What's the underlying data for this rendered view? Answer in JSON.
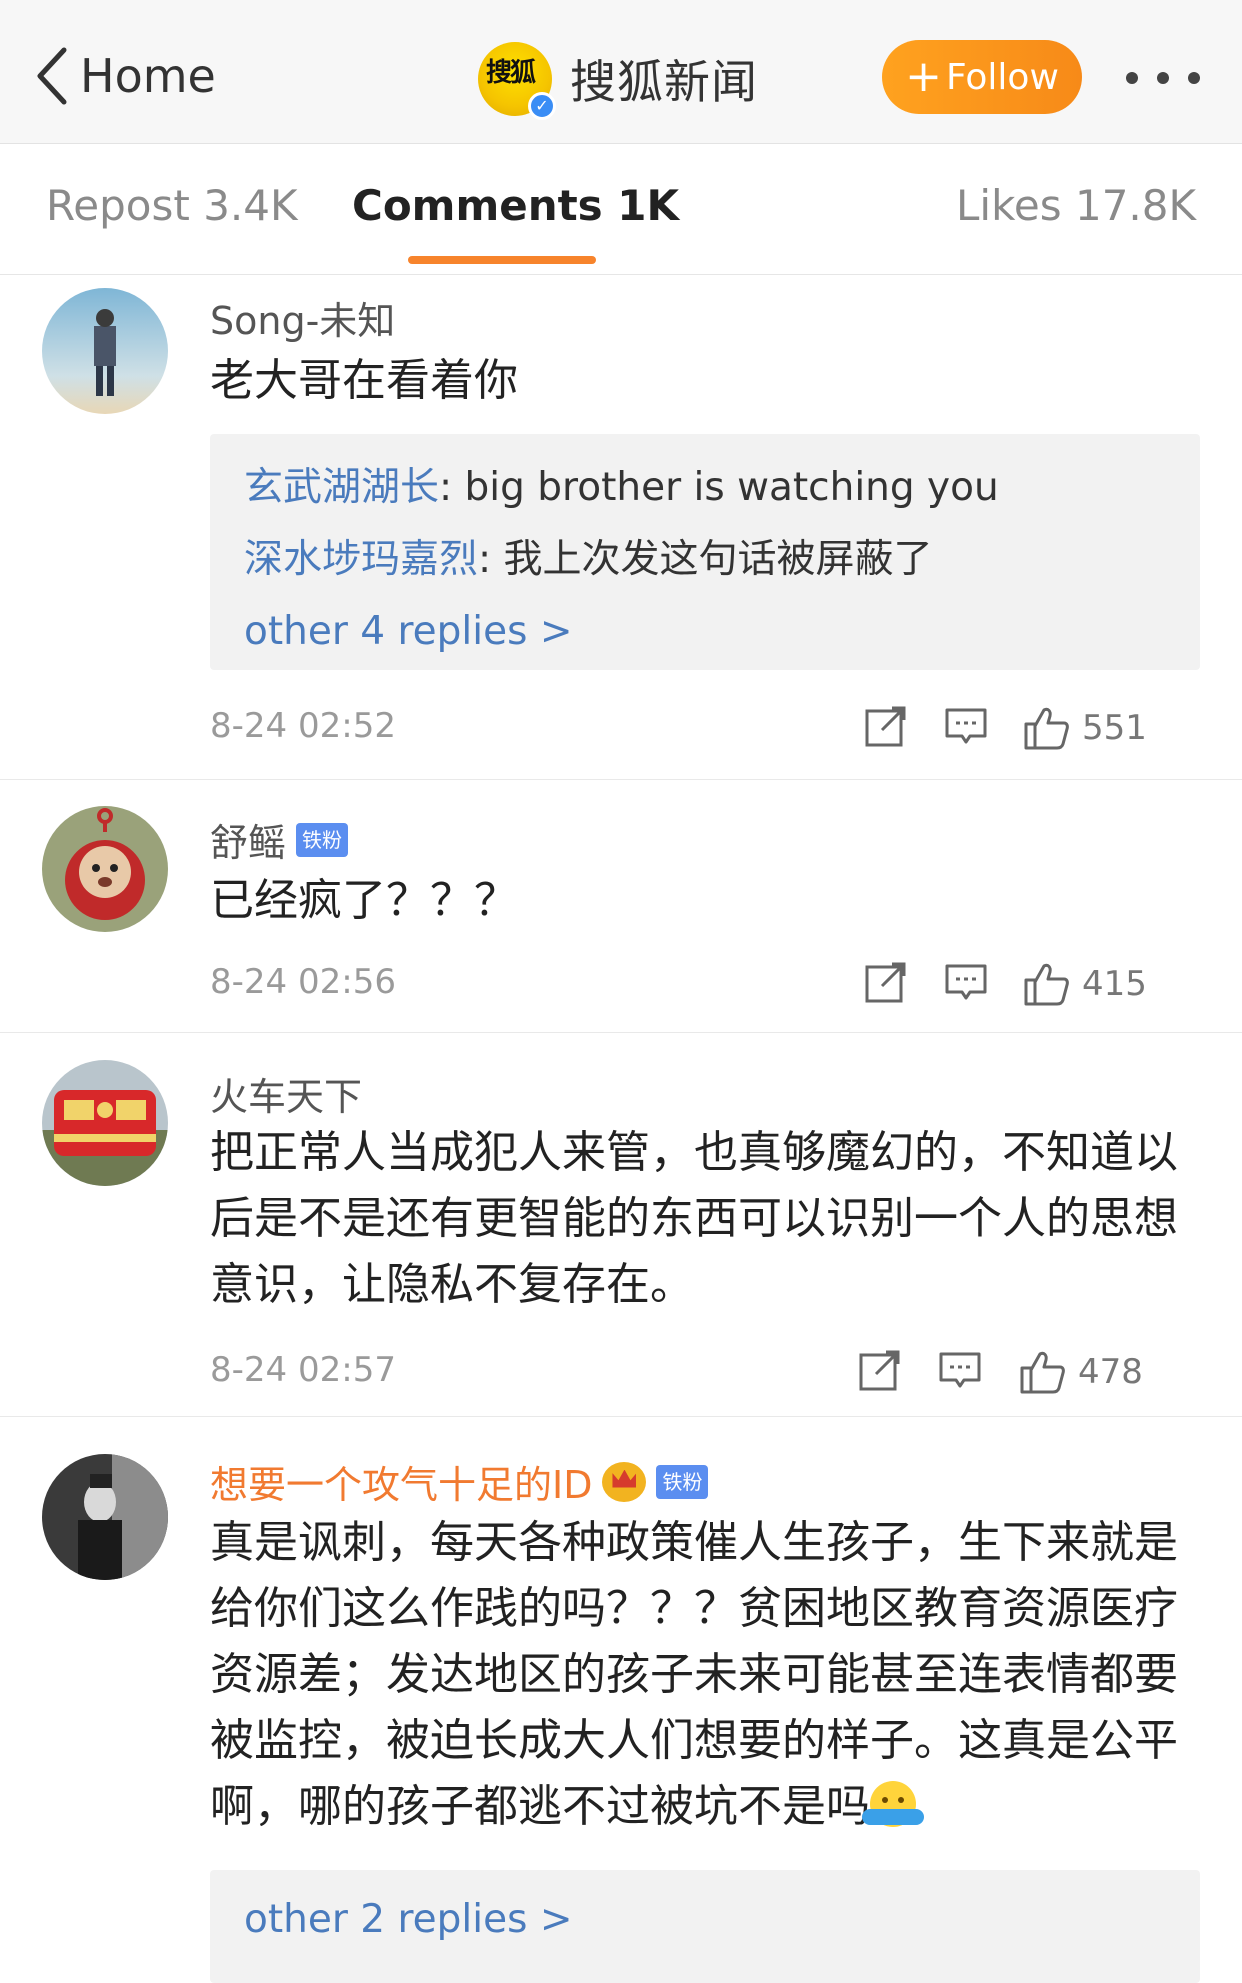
{
  "header": {
    "back_label": "Home",
    "account_name": "搜狐新闻",
    "account_logo_text": "搜狐",
    "follow_label": "Follow"
  },
  "tabs": [
    {
      "label": "Repost 3.4K",
      "active": false
    },
    {
      "label": "Comments 1K",
      "active": true
    },
    {
      "label": "Likes 17.8K",
      "active": false
    }
  ],
  "comments": [
    {
      "user": "Song-未知",
      "text": "老大哥在看着你",
      "replies": [
        {
          "who": "玄武湖湖长",
          "text": ": big brother is watching you"
        },
        {
          "who": "深水埗玛嘉烈",
          "text": ": 我上次发这句话被屏蔽了"
        }
      ],
      "more_replies": "other 4 replies >",
      "time": "8-24 02:52",
      "likes": "551"
    },
    {
      "user": "舒鳐",
      "badge": "铁粉",
      "text": "已经疯了？？？",
      "time": "8-24 02:56",
      "likes": "415"
    },
    {
      "user": "火车天下",
      "text": "把正常人当成犯人来管，也真够魔幻的，不知道以后是不是还有更智能的东西可以识别一个人的思想意识，让隐私不复存在。",
      "time": "8-24 02:57",
      "likes": "478"
    },
    {
      "user": "想要一个攻气十足的ID",
      "badge": "铁粉",
      "text": "真是讽刺，每天各种政策催人生孩子，生下来就是给你们这么作践的吗？？？贫困地区教育资源医疗资源差；发达地区的孩子未来可能甚至连表情都要被监控，被迫长成大人们想要的样子。这真是公平啊，哪的孩子都逃不过被坑不是吗",
      "more_replies": "other 2 replies >"
    }
  ],
  "colors": {
    "accent_orange": "#f7842c",
    "link_blue": "#4a7bbd",
    "badge_blue": "#5b8ef0"
  }
}
